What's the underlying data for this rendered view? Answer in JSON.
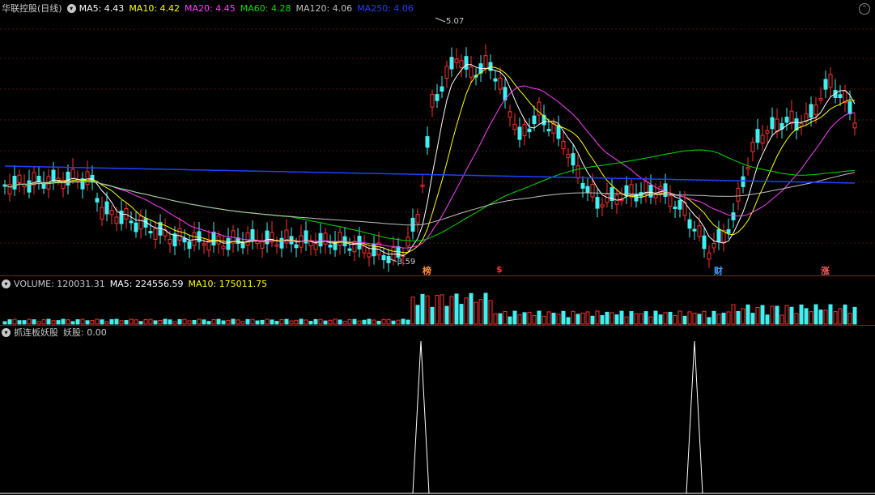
{
  "price_pane": {
    "stock_name": "华联控股(日线)",
    "ma5": "MA5: 4.43",
    "ma10": "MA10: 4.42",
    "ma20": "MA20: 4.45",
    "ma60": "MA60: 4.28",
    "ma120": "MA120: 4.06",
    "ma250": "MA250: 4.06",
    "high_label": "5.07",
    "low_label": "3.59",
    "markers": [
      "榜",
      "$",
      "财",
      "涨"
    ],
    "colors": {
      "ma5": "#ffffff",
      "ma10": "#ffff00",
      "ma20": "#ff40ff",
      "ma60": "#00e000",
      "ma120": "#c0c0c0",
      "ma250": "#2040ff",
      "up": "#ff3030",
      "down": "#40f0f0"
    }
  },
  "volume_pane": {
    "volume": "VOLUME: 120031.31",
    "ma5": "MA5: 224556.59",
    "ma10": "MA10: 175011.75"
  },
  "indicator_pane": {
    "name": "抓连板妖股",
    "value": "妖股: 0.00"
  }
}
